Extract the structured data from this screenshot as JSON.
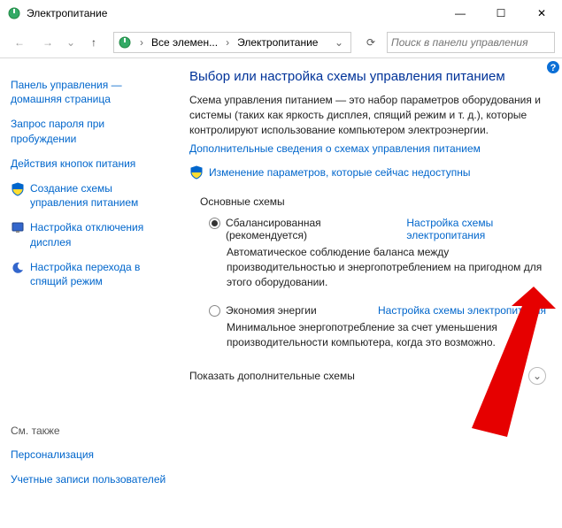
{
  "window": {
    "title": "Электропитание",
    "minimize_glyph": "—",
    "maximize_glyph": "☐",
    "close_glyph": "✕"
  },
  "nav": {
    "back_glyph": "←",
    "forward_glyph": "→",
    "dropdown_glyph": "⌄",
    "up_glyph": "↑",
    "refresh_glyph": "⟳"
  },
  "breadcrumbs": {
    "item1": "Все элемен...",
    "item2": "Электропитание",
    "sep": "›",
    "drop": "⌄"
  },
  "search": {
    "placeholder": "Поиск в панели управления"
  },
  "sidebar": {
    "home": "Панель управления — домашняя страница",
    "items": [
      {
        "label": "Запрос пароля при пробуждении"
      },
      {
        "label": "Действия кнопок питания"
      },
      {
        "label": "Создание схемы управления питанием"
      },
      {
        "label": "Настройка отключения дисплея"
      },
      {
        "label": "Настройка перехода в спящий режим"
      }
    ],
    "see_also": "См. также",
    "see_also_items": [
      {
        "label": "Персонализация"
      },
      {
        "label": "Учетные записи пользователей"
      }
    ]
  },
  "main": {
    "heading": "Выбор или настройка схемы управления питанием",
    "description": "Схема управления питанием — это набор параметров оборудования и системы (таких как яркость дисплея, спящий режим и т. д.), которые контролируют использование компьютером электроэнергии.",
    "more_link": "Дополнительные сведения о схемах управления питанием",
    "change_unavailable": "Изменение параметров, которые сейчас недоступны",
    "basic_plans_label": "Основные схемы",
    "plans": [
      {
        "name": "Сбалансированная",
        "recommended": "(рекомендуется)",
        "config": "Настройка схемы электропитания",
        "desc": "Автоматическое соблюдение баланса между производительностью и энергопотреблением на пригодном для этого оборудовании.",
        "checked": true
      },
      {
        "name": "Экономия энергии",
        "recommended": "",
        "config": "Настройка схемы электропитания",
        "desc": "Минимальное энергопотребление за счет уменьшения производительности компьютера, когда это возможно.",
        "checked": false
      }
    ],
    "show_more": "Показать дополнительные схемы",
    "expand_glyph": "⌄"
  }
}
